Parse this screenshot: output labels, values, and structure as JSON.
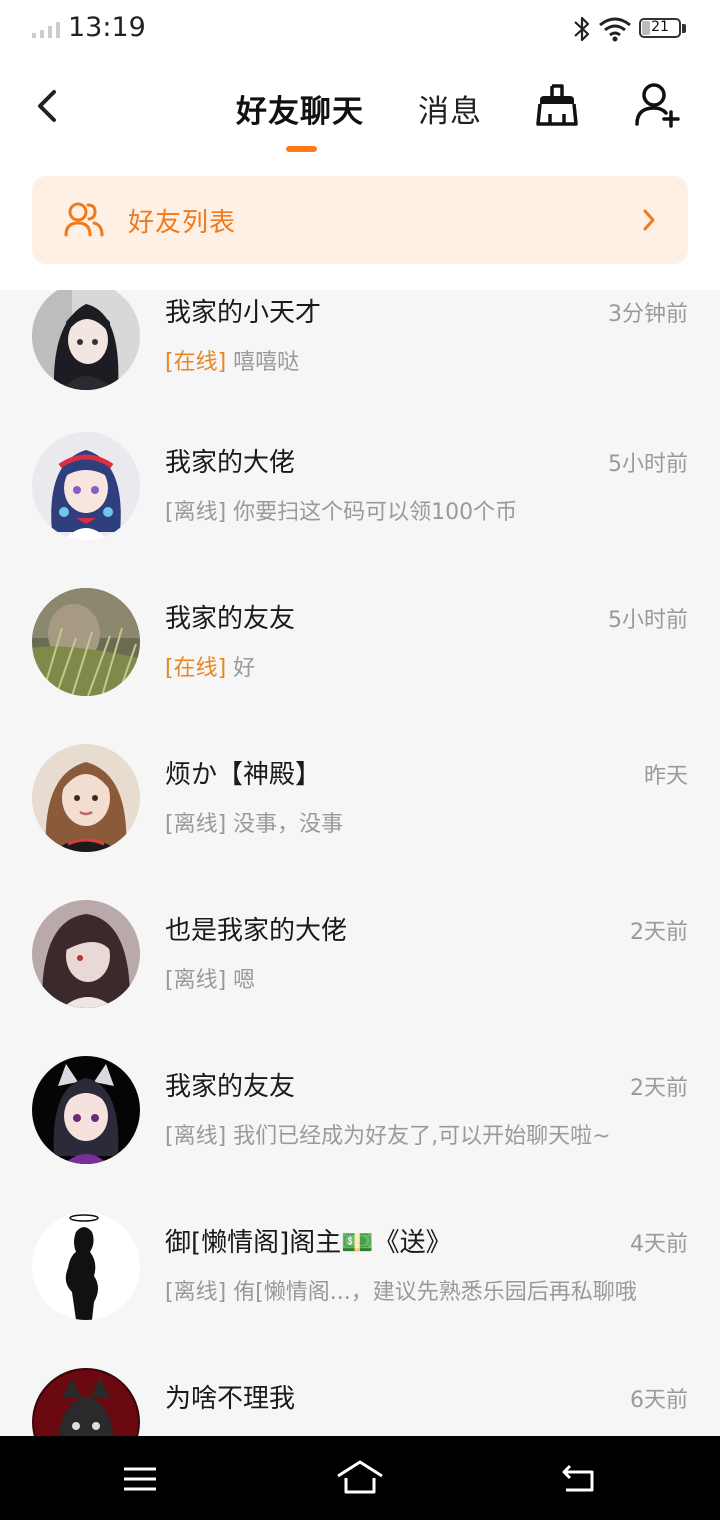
{
  "status_bar": {
    "time": "13:19",
    "battery": "21",
    "battery_level": 0.21
  },
  "header": {
    "tab_friends": "好友聊天",
    "tab_messages": "消息",
    "active_tab": "好友聊天"
  },
  "friend_list_banner": {
    "label": "好友列表"
  },
  "colors": {
    "accent": "#ff7a1a",
    "online": "#e8861f",
    "banner_bg": "#fff0e6"
  },
  "chats": [
    {
      "name": "我家的小天才",
      "time": "3分钟前",
      "status": "[在线]",
      "online": true,
      "message": "嘻嘻哒",
      "avatar": "anime-girl-dark-hair-icon"
    },
    {
      "name": "我家的大佬",
      "time": "5小时前",
      "status": "[离线]",
      "online": false,
      "message": "你要扫这个码可以领100个币",
      "avatar": "anime-girl-blue-hair-icon"
    },
    {
      "name": "我家的友友",
      "time": "5小时前",
      "status": "[在线]",
      "online": true,
      "message": "好",
      "avatar": "grass-photo-icon"
    },
    {
      "name": "烦か【神殿】",
      "time": "昨天",
      "status": "[离线]",
      "online": false,
      "message": "没事，没事",
      "avatar": "girl-selfie-icon"
    },
    {
      "name": "也是我家的大佬",
      "time": "2天前",
      "status": "[离线]",
      "online": false,
      "message": "嗯",
      "avatar": "dark-hair-girl-icon"
    },
    {
      "name": "我家的友友",
      "time": "2天前",
      "status": "[离线]",
      "online": false,
      "message": "我们已经成为好友了,可以开始聊天啦~",
      "avatar": "cat-ear-girl-icon"
    },
    {
      "name": "御[懒情阁]阁主💵《送》",
      "time": "4天前",
      "status": "[离线]",
      "online": false,
      "message": "侑[懒情阁...，建议先熟悉乐园后再私聊哦",
      "avatar": "silhouette-icon"
    },
    {
      "name": "为啥不理我",
      "time": "6天前",
      "status": "",
      "online": false,
      "message": "",
      "avatar": "dark-wolf-icon"
    }
  ]
}
